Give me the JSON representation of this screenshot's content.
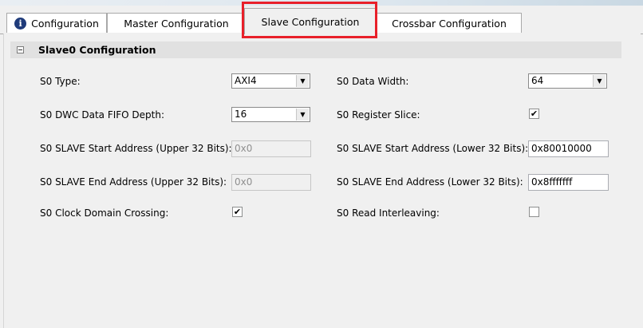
{
  "tabs": [
    {
      "label": "Configuration",
      "icon": "info-icon"
    },
    {
      "label": "Master Configuration"
    },
    {
      "label": "Slave Configuration"
    },
    {
      "label": "Crossbar Configuration"
    }
  ],
  "section": {
    "title": "Slave0 Configuration",
    "icon": "collapse-icon",
    "collapse_symbol": "−"
  },
  "fields": {
    "type": {
      "label": "S0 Type:",
      "value": "AXI4"
    },
    "data_width": {
      "label": "S0 Data Width:",
      "value": "64"
    },
    "dwc_fifo_depth": {
      "label": "S0 DWC Data FIFO Depth:",
      "value": "16"
    },
    "register_slice": {
      "label": "S0 Register Slice:",
      "checked": true
    },
    "start_upper": {
      "label": "S0 SLAVE Start Address (Upper 32 Bits):",
      "value": "0x0"
    },
    "start_lower": {
      "label": "S0 SLAVE Start Address (Lower 32 Bits):",
      "value": "0x80010000"
    },
    "end_upper": {
      "label": "S0 SLAVE End Address (Upper 32 Bits):",
      "value": "0x0"
    },
    "end_lower": {
      "label": "S0 SLAVE End Address (Lower 32 Bits):",
      "value": "0x8fffffff"
    },
    "clock_domain_crossing": {
      "label": "S0 Clock Domain Crossing:",
      "checked": true
    },
    "read_interleaving": {
      "label": "S0 Read Interleaving:",
      "checked": false
    }
  },
  "check_glyph": "✔",
  "dropdown_glyph": "▼",
  "highlight_color": "#e8202a"
}
